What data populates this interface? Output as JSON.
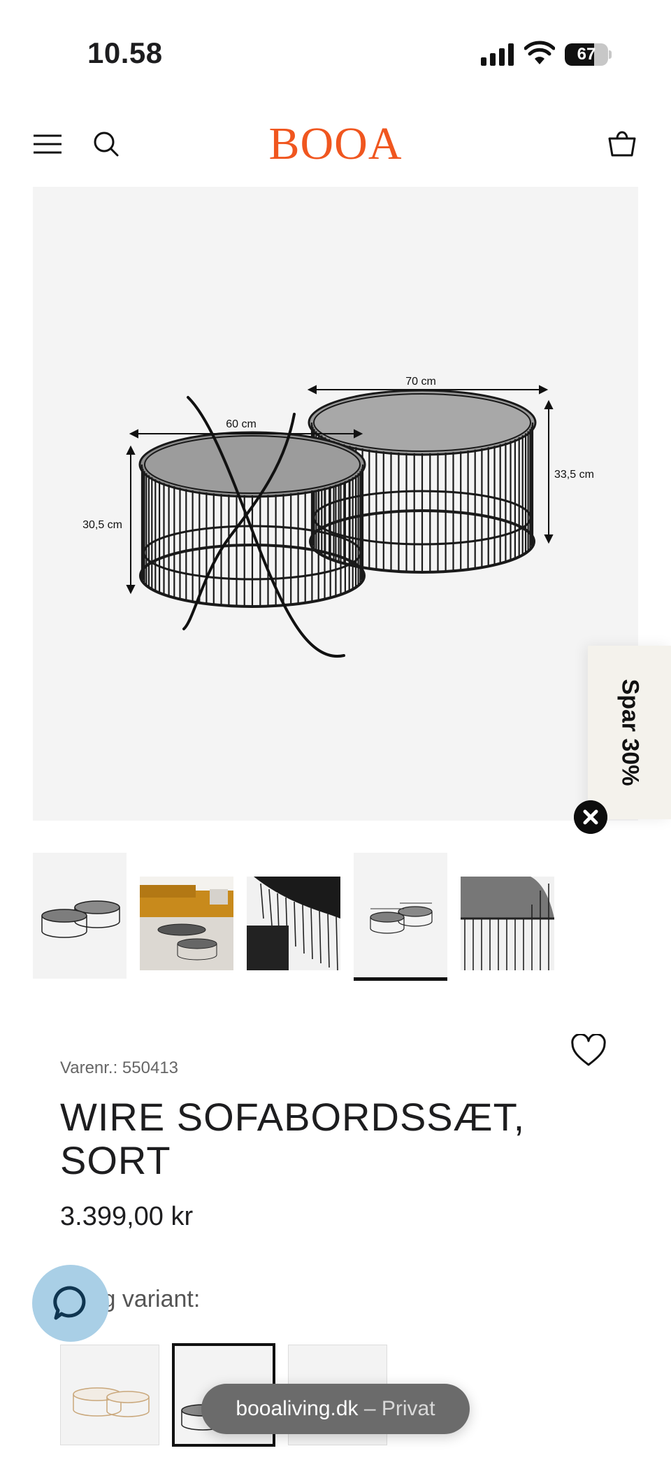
{
  "status_bar": {
    "time": "10.58",
    "battery": "67",
    "battery_fraction": 0.67
  },
  "header": {
    "logo": "BOOA",
    "logo_color": "#f0561f"
  },
  "main_image": {
    "dimension_small_width": "60 cm",
    "dimension_small_height": "30,5 cm",
    "dimension_large_width": "70 cm",
    "dimension_large_height": "33,5 cm"
  },
  "promo": {
    "label": "Spar 30%"
  },
  "thumbnails": [
    {
      "name": "thumb-tables-pair"
    },
    {
      "name": "thumb-livingroom"
    },
    {
      "name": "thumb-detail-close"
    },
    {
      "name": "thumb-dimensions",
      "active": true
    },
    {
      "name": "thumb-detail-wire"
    }
  ],
  "product": {
    "sku": "Varenr.: 550413",
    "title": "WIRE SOFABORDSSÆT, SORT",
    "price": "3.399,00 kr",
    "variant_label": "Vælg variant:"
  },
  "browser": {
    "domain": "booaliving.dk",
    "mode": " – Privat"
  },
  "colors": {
    "accent": "#f0561f",
    "chat": "#a9cfe6"
  }
}
